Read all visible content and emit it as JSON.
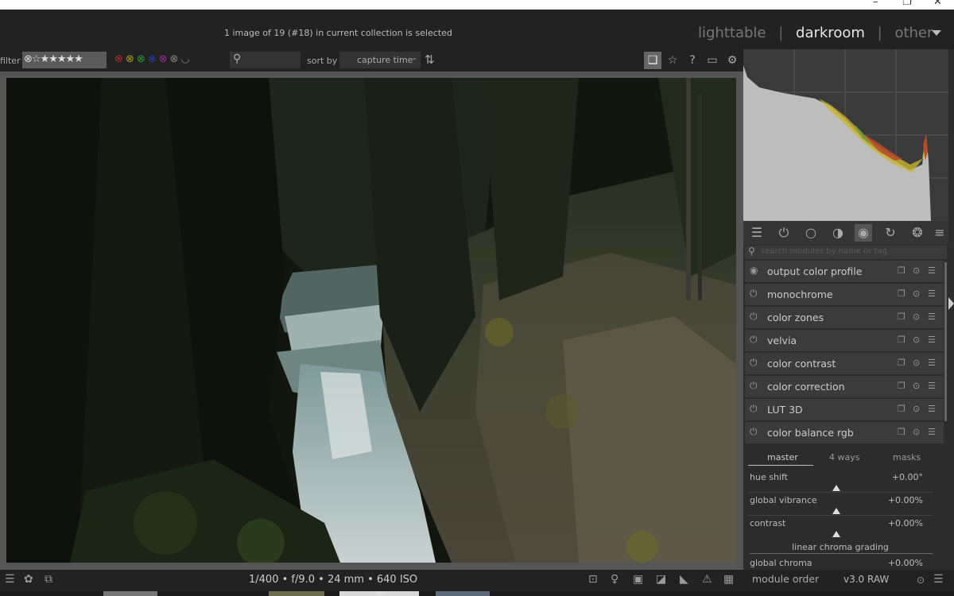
{
  "header": {
    "status_text": "1 image of 19 (#18) in current collection is selected",
    "views": [
      "lighttable",
      "darkroom",
      "other"
    ],
    "separator": "|",
    "active_view": "darkroom"
  },
  "filter_bar": {
    "filter_label": "filter",
    "rating_value": "⊗☆★★★★★",
    "color_labels": [
      "red",
      "yellow",
      "green",
      "blue",
      "purple"
    ],
    "sort_label": "sort by",
    "sort_value": "capture time",
    "icons": [
      "grouping-icon",
      "star-icon",
      "help-icon",
      "keyboard-icon",
      "settings-icon"
    ]
  },
  "histogram": {
    "colors": {
      "bg": "#3a3a3a",
      "fill": "#bdbdbd",
      "red": "#b94a2a",
      "yellow": "#c8b530",
      "green": "#6e9a3c"
    }
  },
  "module_panel": {
    "search_placeholder": "search modules by name or tag",
    "group_icons": [
      "quick-access-icon",
      "active-modules-icon",
      "base-icon",
      "tone-icon",
      "color-icon",
      "correct-icon",
      "effect-icon",
      "menu-icon"
    ],
    "modules": [
      {
        "name": "output color profile"
      },
      {
        "name": "monochrome"
      },
      {
        "name": "color zones"
      },
      {
        "name": "velvia"
      },
      {
        "name": "color contrast"
      },
      {
        "name": "color correction"
      },
      {
        "name": "LUT 3D"
      },
      {
        "name": "color balance rgb"
      }
    ],
    "color_balance": {
      "tabs": [
        "master",
        "4 ways",
        "masks"
      ],
      "sliders": [
        {
          "label": "hue shift",
          "value": "+0.00°"
        },
        {
          "label": "global vibrance",
          "value": "+0.00%"
        },
        {
          "label": "contrast",
          "value": "+0.00%"
        }
      ],
      "section_title": "linear chroma grading",
      "last_slider": {
        "label": "global chroma",
        "value": "+0.00%"
      }
    }
  },
  "bottom_bar": {
    "exif": "1/400 • f/9.0 • 24 mm • 640 ISO",
    "module_order_label": "module order",
    "module_order_value": "v3.0 RAW"
  }
}
